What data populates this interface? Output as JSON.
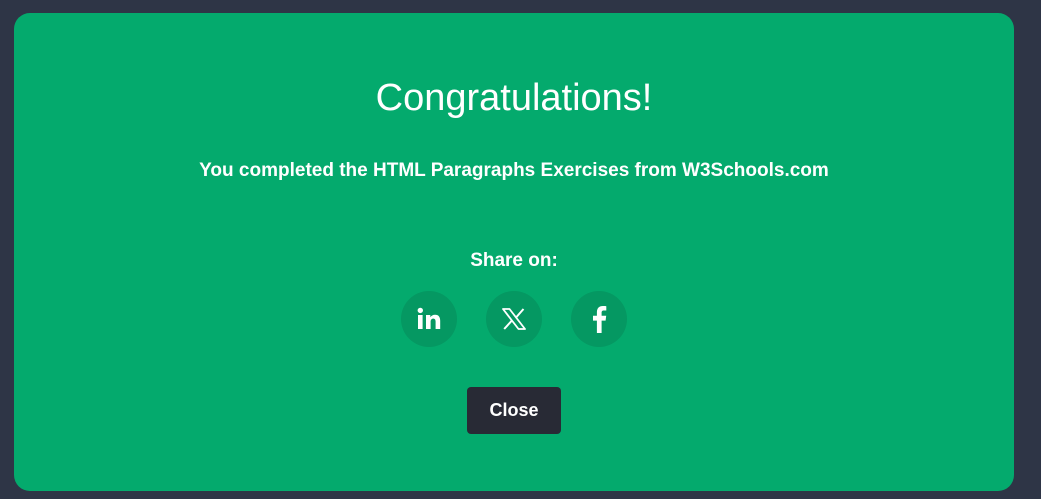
{
  "modal": {
    "title": "Congratulations!",
    "message": "You completed the HTML Paragraphs Exercises from W3Schools.com",
    "share_label": "Share on:",
    "share_buttons": [
      {
        "name": "linkedin",
        "icon": "linkedin-icon"
      },
      {
        "name": "x",
        "icon": "x-icon"
      },
      {
        "name": "facebook",
        "icon": "facebook-icon"
      }
    ],
    "close_label": "Close"
  },
  "colors": {
    "backdrop": "#2e3546",
    "modal_background": "#04aa6d",
    "share_circle": "#059862",
    "close_button": "#282a35",
    "text": "#ffffff"
  }
}
